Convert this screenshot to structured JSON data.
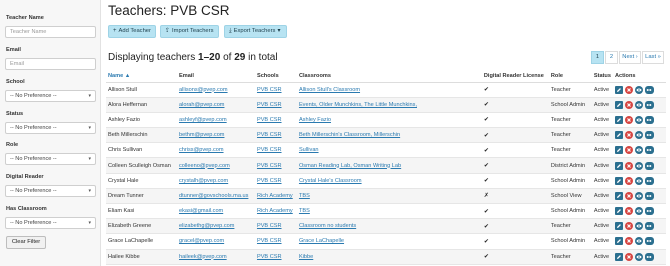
{
  "page": {
    "title": "Teachers: PVB CSR"
  },
  "toolbar": {
    "add": "Add Teacher",
    "import": "Import Teachers",
    "export": "Export Teachers"
  },
  "display": {
    "prefix": "Displaying teachers ",
    "range": "1–20",
    "mid": " of ",
    "total": "29",
    "suffix": " in total"
  },
  "pagination": {
    "p1": "1",
    "p2": "2",
    "next": "Next ›",
    "last": "Last »"
  },
  "filters": {
    "name_label": "Teacher Name",
    "name_placeholder": "Teacher Name",
    "email_label": "Email",
    "email_placeholder": "Email",
    "school_label": "School",
    "school_value": "-- No Preference --",
    "status_label": "Status",
    "status_value": "-- No Preference --",
    "role_label": "Role",
    "role_value": "-- No Preference --",
    "reader_label": "Digital Reader",
    "reader_value": "-- No Preference --",
    "classroom_label": "Has Classroom",
    "classroom_value": "-- No Preference --",
    "clear": "Clear Filter"
  },
  "table": {
    "headers": {
      "name": "Name ▲",
      "email": "Email",
      "schools": "Schools",
      "classrooms": "Classrooms",
      "license": "Digital Reader License",
      "role": "Role",
      "status": "Status",
      "actions": "Actions"
    },
    "rows": [
      {
        "name": "Allison Stull",
        "email": "allisons@pvep.com",
        "school": "PVB CSR",
        "classrooms": "Allison Stull's Classroom",
        "license": "✔",
        "role": "Teacher",
        "status": "Active"
      },
      {
        "name": "Alora Heffernan",
        "email": "alorah@pvep.com",
        "school": "PVB CSR",
        "classrooms": "Events, Older Munchkins, The Little Munchkins,",
        "license": "✔",
        "role": "School Admin",
        "status": "Active"
      },
      {
        "name": "Ashley Fazio",
        "email": "ashleyf@pvep.com",
        "school": "PVB CSR",
        "classrooms": "Ashley Fazio",
        "license": "✔",
        "role": "Teacher",
        "status": "Active"
      },
      {
        "name": "Beth Millerschin",
        "email": "bethm@pvep.com",
        "school": "PVB CSR",
        "classrooms": "Beth Millerschin's Classroom, Millerschin",
        "license": "✔",
        "role": "Teacher",
        "status": "Active"
      },
      {
        "name": "Chris Sullivan",
        "email": "chriss@pvep.com",
        "school": "PVB CSR",
        "classrooms": "Sullivan",
        "license": "✔",
        "role": "Teacher",
        "status": "Active"
      },
      {
        "name": "Colleen Sculleigh Osman",
        "email": "colleeno@pvep.com",
        "school": "PVB CSR",
        "classrooms": "Osman Reading Lab, Osman Writing Lab",
        "license": "✔",
        "role": "District Admin",
        "status": "Active"
      },
      {
        "name": "Crystal Hale",
        "email": "crystalh@pvep.com",
        "school": "PVB CSR",
        "classrooms": "Crystal Hale's Classroom",
        "license": "✔",
        "role": "School Admin",
        "status": "Active"
      },
      {
        "name": "Dream Tunner",
        "email": "dtunner@govschools.ma.us",
        "school": "Rich Academy",
        "classrooms": "TBS",
        "license": "✗",
        "role": "School View",
        "status": "Active"
      },
      {
        "name": "Eliam Kasi",
        "email": "ekasi@gmail.com",
        "school": "Rich Academy",
        "classrooms": "TBS",
        "license": "✔",
        "role": "School Admin",
        "status": "Active"
      },
      {
        "name": "Elizabeth Greene",
        "email": "elizabethg@pvep.com",
        "school": "PVB CSR",
        "classrooms": "Classroom no students",
        "license": "✔",
        "role": "Teacher",
        "status": "Active"
      },
      {
        "name": "Grace LaChapelle",
        "email": "gracel@pvep.com",
        "school": "PVB CSR",
        "classrooms": "Grace LaChapelle",
        "license": "✔",
        "role": "School Admin",
        "status": "Active"
      },
      {
        "name": "Hailee Kibbe",
        "email": "haileek@pvep.com",
        "school": "PVB CSR",
        "classrooms": "Kibbe",
        "license": "✔",
        "role": "Teacher",
        "status": "Active"
      }
    ]
  },
  "icons": {
    "edit": "pencil-icon",
    "delete": "x-circle-icon",
    "view": "eye-icon",
    "impersonate": "mask-icon"
  },
  "colors": {
    "accent": "#b7e3f2",
    "link": "#2a7ab0",
    "danger": "#d64541",
    "action": "#2b6f8f"
  }
}
